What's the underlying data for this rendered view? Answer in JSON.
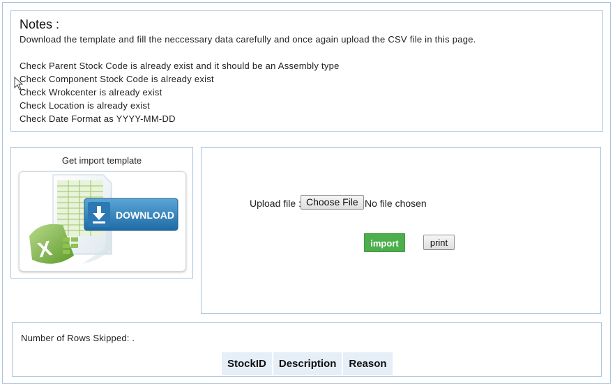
{
  "notes": {
    "title": "Notes :",
    "intro": "Download the template and fill the neccessary data carefully and once again upload the CSV file in this page.",
    "checks": [
      "Check Parent Stock Code is already exist and it should be an Assembly type",
      "Check Component Stock Code is already exist",
      "Check Wrokcenter is already exist",
      "Check Location is already exist",
      "Check Date Format as YYYY-MM-DD"
    ]
  },
  "template": {
    "title": "Get import template",
    "download_label": "DOWNLOAD",
    "icons": [
      "spreadsheet-icon",
      "excel-icon",
      "download-arrow-icon"
    ]
  },
  "upload": {
    "label": "Upload file :",
    "choose_button": "Choose File",
    "file_status": "No file chosen",
    "import_button": "import",
    "print_button": "print"
  },
  "result": {
    "skipped_text": "Number of Rows Skipped: .",
    "columns": [
      "StockID",
      "Description",
      "Reason"
    ]
  },
  "colors": {
    "panel_border": "#a9c4de",
    "import_green": "#4cae4c",
    "download_blue": "#2f7fb8",
    "table_header_bg": "#e6eef8"
  }
}
